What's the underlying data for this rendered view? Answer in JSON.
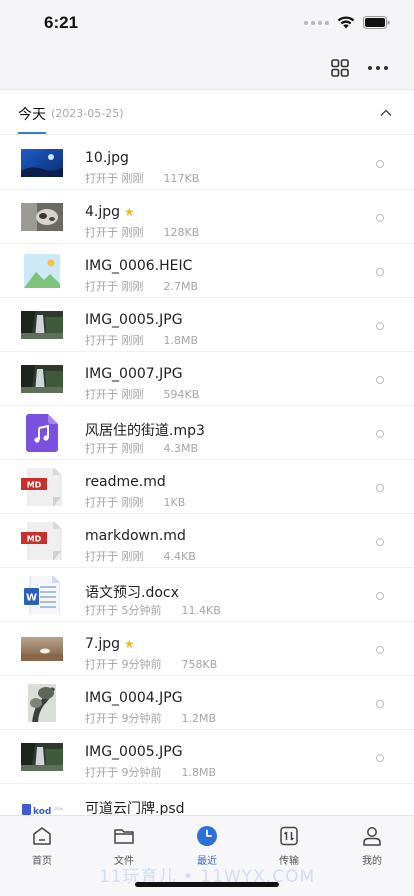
{
  "status_bar": {
    "time": "6:21"
  },
  "section": {
    "title": "今天",
    "date": "(2023-05-25)"
  },
  "files": [
    {
      "name": "10.jpg",
      "starred": false,
      "opened_label": "打开于",
      "opened_time": "刚刚",
      "size": "117KB",
      "thumb": "photo-blue-icon"
    },
    {
      "name": "4.jpg",
      "starred": true,
      "opened_label": "打开于",
      "opened_time": "刚刚",
      "size": "128KB",
      "thumb": "photo-cat-icon"
    },
    {
      "name": "IMG_0006.HEIC",
      "starred": false,
      "opened_label": "打开于",
      "opened_time": "刚刚",
      "size": "2.7MB",
      "thumb": "image-placeholder-icon"
    },
    {
      "name": "IMG_0005.JPG",
      "starred": false,
      "opened_label": "打开于",
      "opened_time": "刚刚",
      "size": "1.8MB",
      "thumb": "photo-waterfall-icon"
    },
    {
      "name": "IMG_0007.JPG",
      "starred": false,
      "opened_label": "打开于",
      "opened_time": "刚刚",
      "size": "594KB",
      "thumb": "photo-waterfall-icon"
    },
    {
      "name": "风居住的街道.mp3",
      "starred": false,
      "opened_label": "打开于",
      "opened_time": "刚刚",
      "size": "4.3MB",
      "thumb": "audio-file-icon"
    },
    {
      "name": "readme.md",
      "starred": false,
      "opened_label": "打开于",
      "opened_time": "刚刚",
      "size": "1KB",
      "thumb": "markdown-file-icon"
    },
    {
      "name": "markdown.md",
      "starred": false,
      "opened_label": "打开于",
      "opened_time": "刚刚",
      "size": "4.4KB",
      "thumb": "markdown-file-icon"
    },
    {
      "name": "语文预习.docx",
      "starred": false,
      "opened_label": "打开于",
      "opened_time": "5分钟前",
      "size": "11.4KB",
      "thumb": "word-file-icon"
    },
    {
      "name": "7.jpg",
      "starred": true,
      "opened_label": "打开于",
      "opened_time": "9分钟前",
      "size": "758KB",
      "thumb": "photo-beach-icon"
    },
    {
      "name": "IMG_0004.JPG",
      "starred": false,
      "opened_label": "打开于",
      "opened_time": "9分钟前",
      "size": "1.2MB",
      "thumb": "photo-tree-icon"
    },
    {
      "name": "IMG_0005.JPG",
      "starred": false,
      "opened_label": "打开于",
      "opened_time": "9分钟前",
      "size": "1.8MB",
      "thumb": "photo-waterfall-icon"
    },
    {
      "name": "可道云门牌.psd",
      "starred": false,
      "opened_label": "",
      "opened_time": "",
      "size": "",
      "thumb": "psd-file-icon"
    }
  ],
  "tabs": [
    {
      "label": "首页",
      "icon": "home-icon",
      "active": false
    },
    {
      "label": "文件",
      "icon": "folder-icon",
      "active": false
    },
    {
      "label": "最近",
      "icon": "clock-icon",
      "active": true
    },
    {
      "label": "传输",
      "icon": "transfer-icon",
      "active": false
    },
    {
      "label": "我的",
      "icon": "user-icon",
      "active": false
    }
  ],
  "watermark": "11玩育儿 • 11WYX.COM",
  "colors": {
    "accent": "#2f6fd8",
    "star": "#f2b61f",
    "audio_purple": "#7b4fe0",
    "markdown_red": "#c9302c",
    "word_blue": "#2b5fb8"
  }
}
